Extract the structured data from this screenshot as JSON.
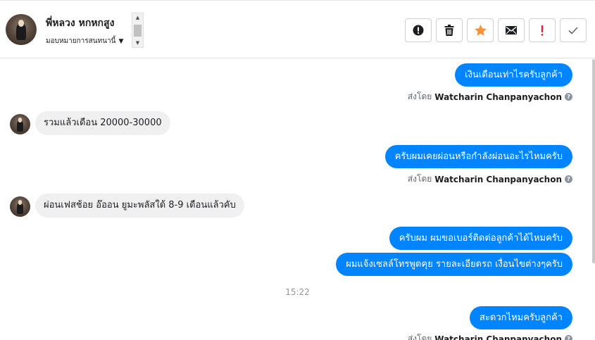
{
  "header": {
    "contact_name": "พี่หลวง หกหกสูง",
    "assign_label": "มอบหมายการสนทนานี้",
    "assign_caret_icon": "caret-down-icon",
    "actions": [
      {
        "name": "mark-spam-button",
        "icon": "exclamation-circle-icon",
        "color": "#1c1e21"
      },
      {
        "name": "delete-button",
        "icon": "trash-icon",
        "color": "#1c1e21"
      },
      {
        "name": "star-button",
        "icon": "star-icon",
        "color": "#f7923b"
      },
      {
        "name": "mark-unread-button",
        "icon": "envelope-icon",
        "color": "#1c1e21"
      },
      {
        "name": "important-button",
        "icon": "exclamation-icon",
        "color": "#e41e3f"
      },
      {
        "name": "mark-done-button",
        "icon": "check-icon",
        "color": "#606770"
      }
    ]
  },
  "chat": {
    "sent_by_prefix": "ส่งโดย",
    "sender_name": "Watcharin Chanpanyachon",
    "messages": [
      {
        "dir": "out",
        "text": "เงินเดือนเท่าไรครับลูกค้า"
      },
      {
        "dir": "in",
        "text": "รวมแล้วเดือน 20000-30000"
      },
      {
        "dir": "out",
        "text": "ครับผมเคยผ่อนหรือกำลังผ่อนอะไรไหมครับ"
      },
      {
        "dir": "in",
        "text": "ผ่อนเฟสช้อย อ๊ออน ยูมะพลัสใด้ 8-9 เดือนแล้วคับ"
      },
      {
        "dir": "out",
        "text": "ครับผม ผมขอเบอร์ติดต่อลูกค้าได้ไหมครับ"
      },
      {
        "dir": "out",
        "text": "ผมแจ้งเซลล์โทรพูดคุย รายละเอียดรถ เงื่อนไขต่างๆครับ"
      },
      {
        "dir": "out",
        "text": "สะดวกไหมครับลูกค้า"
      }
    ],
    "timestamp": "15:22"
  },
  "colors": {
    "outgoing_bubble": "#0084ff",
    "incoming_bubble": "#f0f0f0"
  }
}
